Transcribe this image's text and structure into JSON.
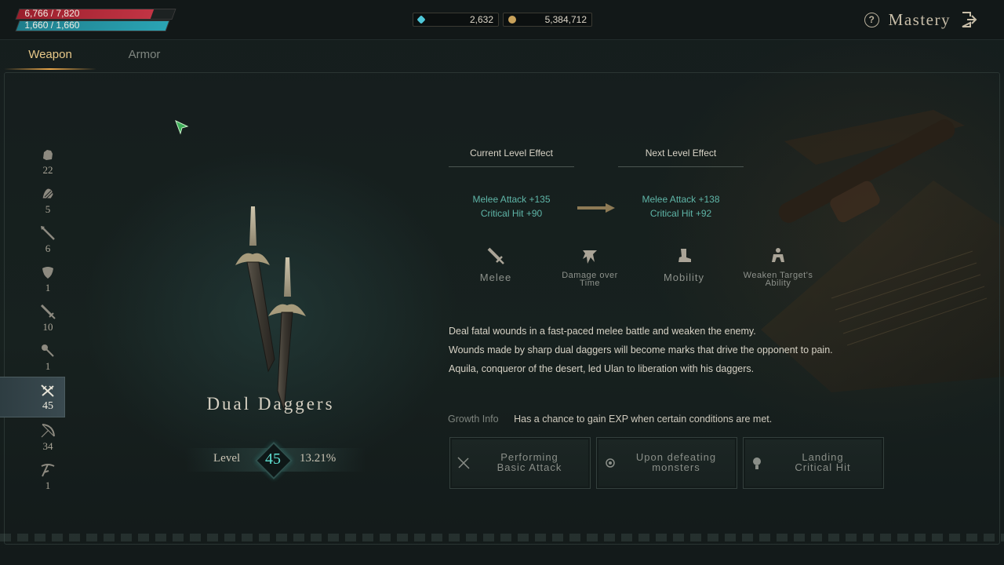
{
  "player": {
    "hp_text": "6,766 / 7,820",
    "hp_fraction": 0.865,
    "mp_text": "1,660 / 1,660",
    "mp_fraction": 1.0
  },
  "currency": [
    {
      "icon": "gem-icon",
      "value": "2,632",
      "color": "#4fc7d8"
    },
    {
      "icon": "gold-coin-icon",
      "value": "5,384,712",
      "color": "#c8a15a"
    }
  ],
  "header": {
    "title": "Mastery",
    "help_glyph": "?"
  },
  "tabs": [
    {
      "label": "Weapon",
      "active": true
    },
    {
      "label": "Armor",
      "active": false
    }
  ],
  "weapon_list": [
    {
      "icon": "gauntlet-icon",
      "count": "22"
    },
    {
      "icon": "claw-icon",
      "count": "5"
    },
    {
      "icon": "spear-icon",
      "count": "6"
    },
    {
      "icon": "shield-icon",
      "count": "1"
    },
    {
      "icon": "sword-icon",
      "count": "10"
    },
    {
      "icon": "mace-icon",
      "count": "1"
    },
    {
      "icon": "dual-daggers-icon",
      "count": "45",
      "selected": true
    },
    {
      "icon": "bow-icon",
      "count": "34"
    },
    {
      "icon": "crossbow-icon",
      "count": "1"
    }
  ],
  "weapon": {
    "name": "Dual Daggers",
    "level_label": "Level",
    "level": "45",
    "exp_percent": "13.21%"
  },
  "effects": {
    "current_header": "Current Level Effect",
    "next_header": "Next Level Effect",
    "current": [
      "Melee Attack +135",
      "Critical Hit +90"
    ],
    "next": [
      "Melee Attack +138",
      "Critical Hit +92"
    ]
  },
  "categories": [
    {
      "icon": "melee-icon",
      "label": "Melee"
    },
    {
      "icon": "damage-over-time-icon",
      "label_lines": [
        "Damage over",
        "Time"
      ]
    },
    {
      "icon": "mobility-icon",
      "label": "Mobility"
    },
    {
      "icon": "weaken-icon",
      "label_lines": [
        "Weaken Target's",
        "Ability"
      ]
    }
  ],
  "description": [
    "Deal fatal wounds in a fast-paced melee battle and weaken the enemy.",
    "Wounds made by sharp dual daggers will become marks that drive the opponent to pain.",
    "Aquila, conqueror of the desert, led Ulan to liberation with his daggers."
  ],
  "growth": {
    "label": "Growth Info",
    "text": "Has a chance to gain EXP when certain conditions are met.",
    "conditions": [
      {
        "icon": "basic-attack-icon",
        "lines": [
          "Performing",
          "Basic Attack"
        ]
      },
      {
        "icon": "monster-target-icon",
        "lines": [
          "Upon defeating",
          "monsters"
        ]
      },
      {
        "icon": "critical-hit-icon",
        "lines": [
          "Landing",
          "Critical Hit"
        ]
      }
    ]
  }
}
